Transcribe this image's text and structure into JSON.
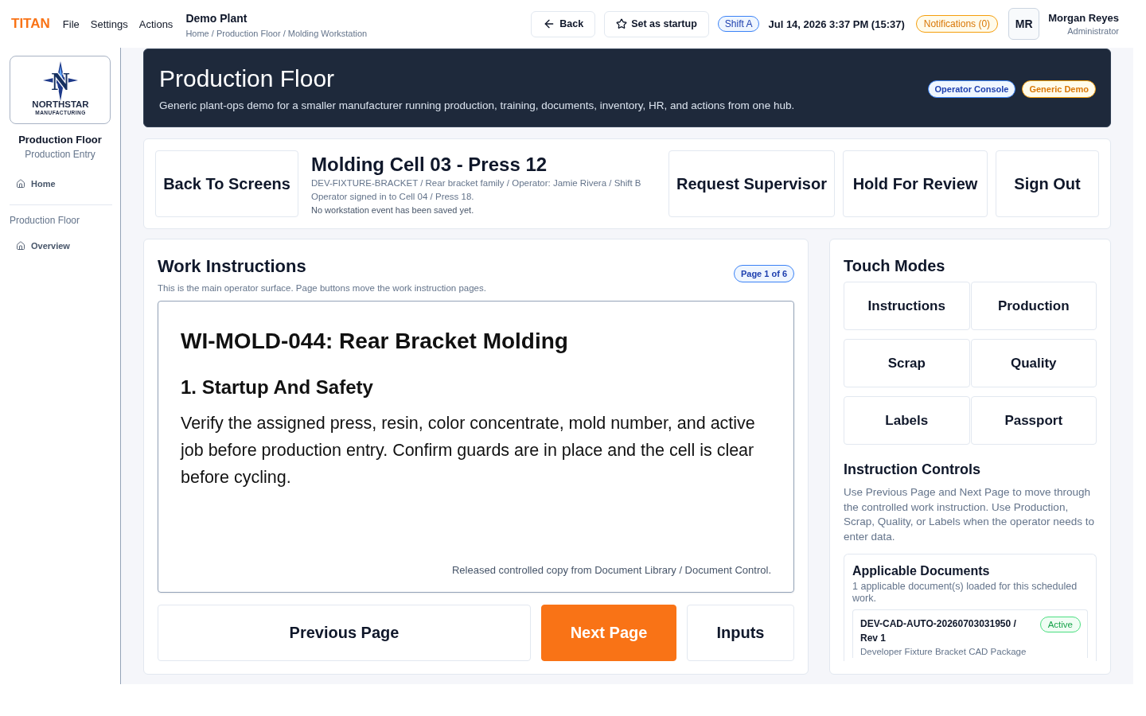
{
  "top_bar": {
    "brand": "TITAN",
    "menu": [
      "File",
      "Settings",
      "Actions"
    ],
    "plant": "Demo Plant",
    "breadcrumb": "Home / Production Floor / Molding Workstation",
    "back_button": "Back",
    "startup_button": "Set as startup",
    "shift": "Shift A",
    "datetime": "Jul 14, 2026 3:37 PM (15:37)",
    "notifications": "Notifications (0)",
    "user": {
      "initials": "MR",
      "name": "Morgan Reyes",
      "role": "Administrator"
    }
  },
  "sidebar": {
    "logo": {
      "monogram": "N",
      "name": "NORTHSTAR",
      "tagline": "MANUFACTURING"
    },
    "title": "Production Floor",
    "subtitle": "Production Entry",
    "items": [
      {
        "label": "Home"
      }
    ],
    "sections": [
      {
        "heading": "Production Floor",
        "items": [
          {
            "label": "Overview"
          }
        ]
      }
    ]
  },
  "banner": {
    "title": "Production Floor",
    "description": "Generic plant-ops demo for a smaller manufacturer running production, training, documents, inventory, HR, and actions from one hub.",
    "badges": [
      {
        "label": "Operator Console",
        "kind": "info"
      },
      {
        "label": "Generic Demo",
        "kind": "warning"
      }
    ]
  },
  "workstation": {
    "back_button": "Back To Screens",
    "title": "Molding Cell 03 - Press 12",
    "details": [
      "DEV-FIXTURE-BRACKET / Rear bracket family / Operator: Jamie Rivera / Shift B",
      "Operator signed in to Cell 04 / Press 18."
    ],
    "status": "No workstation event has been saved yet.",
    "actions": [
      "Request Supervisor",
      "Hold For Review",
      "Sign Out"
    ]
  },
  "work_instructions": {
    "title": "Work Instructions",
    "description": "This is the main operator surface. Page buttons move the work instruction pages.",
    "page_badge": "Page 1 of 6",
    "document": {
      "title": "WI-MOLD-044: Rear Bracket Molding",
      "section": "1. Startup And Safety",
      "body": "Verify the assigned press, resin, color concentrate, mold number, and active job before production entry. Confirm guards are in place and the cell is clear before cycling.",
      "footer": "Released controlled copy from Document Library / Document Control."
    },
    "buttons": [
      {
        "label": "Previous Page",
        "kind": "secondary"
      },
      {
        "label": "Next Page",
        "kind": "primary"
      },
      {
        "label": "Inputs",
        "kind": "secondary"
      }
    ]
  },
  "touch_modes": {
    "title": "Touch Modes",
    "modes": [
      {
        "label": "Instructions"
      },
      {
        "label": "Production"
      },
      {
        "label": "Scrap"
      },
      {
        "label": "Quality"
      },
      {
        "label": "Labels"
      },
      {
        "label": "Passport"
      }
    ]
  },
  "instruction_controls": {
    "title": "Instruction Controls",
    "text": "Use Previous Page and Next Page to move through the controlled work instruction. Use Production, Scrap, Quality, or Labels when the operator needs to enter data."
  },
  "applicable_documents": {
    "title": "Applicable Documents",
    "summary": "1 applicable document(s) loaded for this scheduled work.",
    "items": [
      {
        "code": "DEV-CAD-AUTO-20260703031950 / Rev 1",
        "name": "Developer Fixture Bracket CAD Package",
        "status": {
          "label": "Active",
          "kind": "success"
        }
      }
    ]
  }
}
